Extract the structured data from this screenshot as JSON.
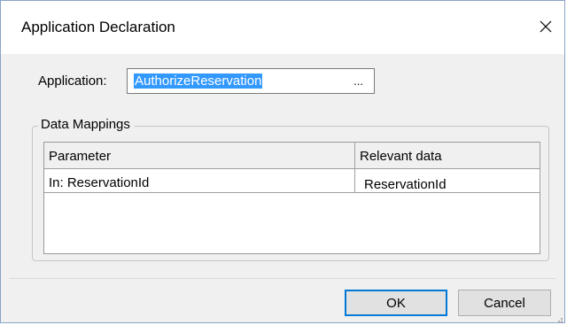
{
  "window": {
    "title": "Application Declaration",
    "close_icon": "close-icon"
  },
  "application": {
    "label": "Application:",
    "value": "AuthorizeReservation",
    "browse_label": "..."
  },
  "data_mappings": {
    "group_title": "Data Mappings",
    "columns": [
      "Parameter",
      "Relevant data"
    ],
    "rows": [
      {
        "parameter": "In: ReservationId",
        "relevant_data": "ReservationId"
      }
    ]
  },
  "buttons": {
    "ok": "OK",
    "cancel": "Cancel"
  },
  "colors": {
    "selection": "#3399ff",
    "default_button_border": "#0078d7",
    "dialog_background": "#f0f0f0",
    "window_border": "#8aa4c8"
  }
}
